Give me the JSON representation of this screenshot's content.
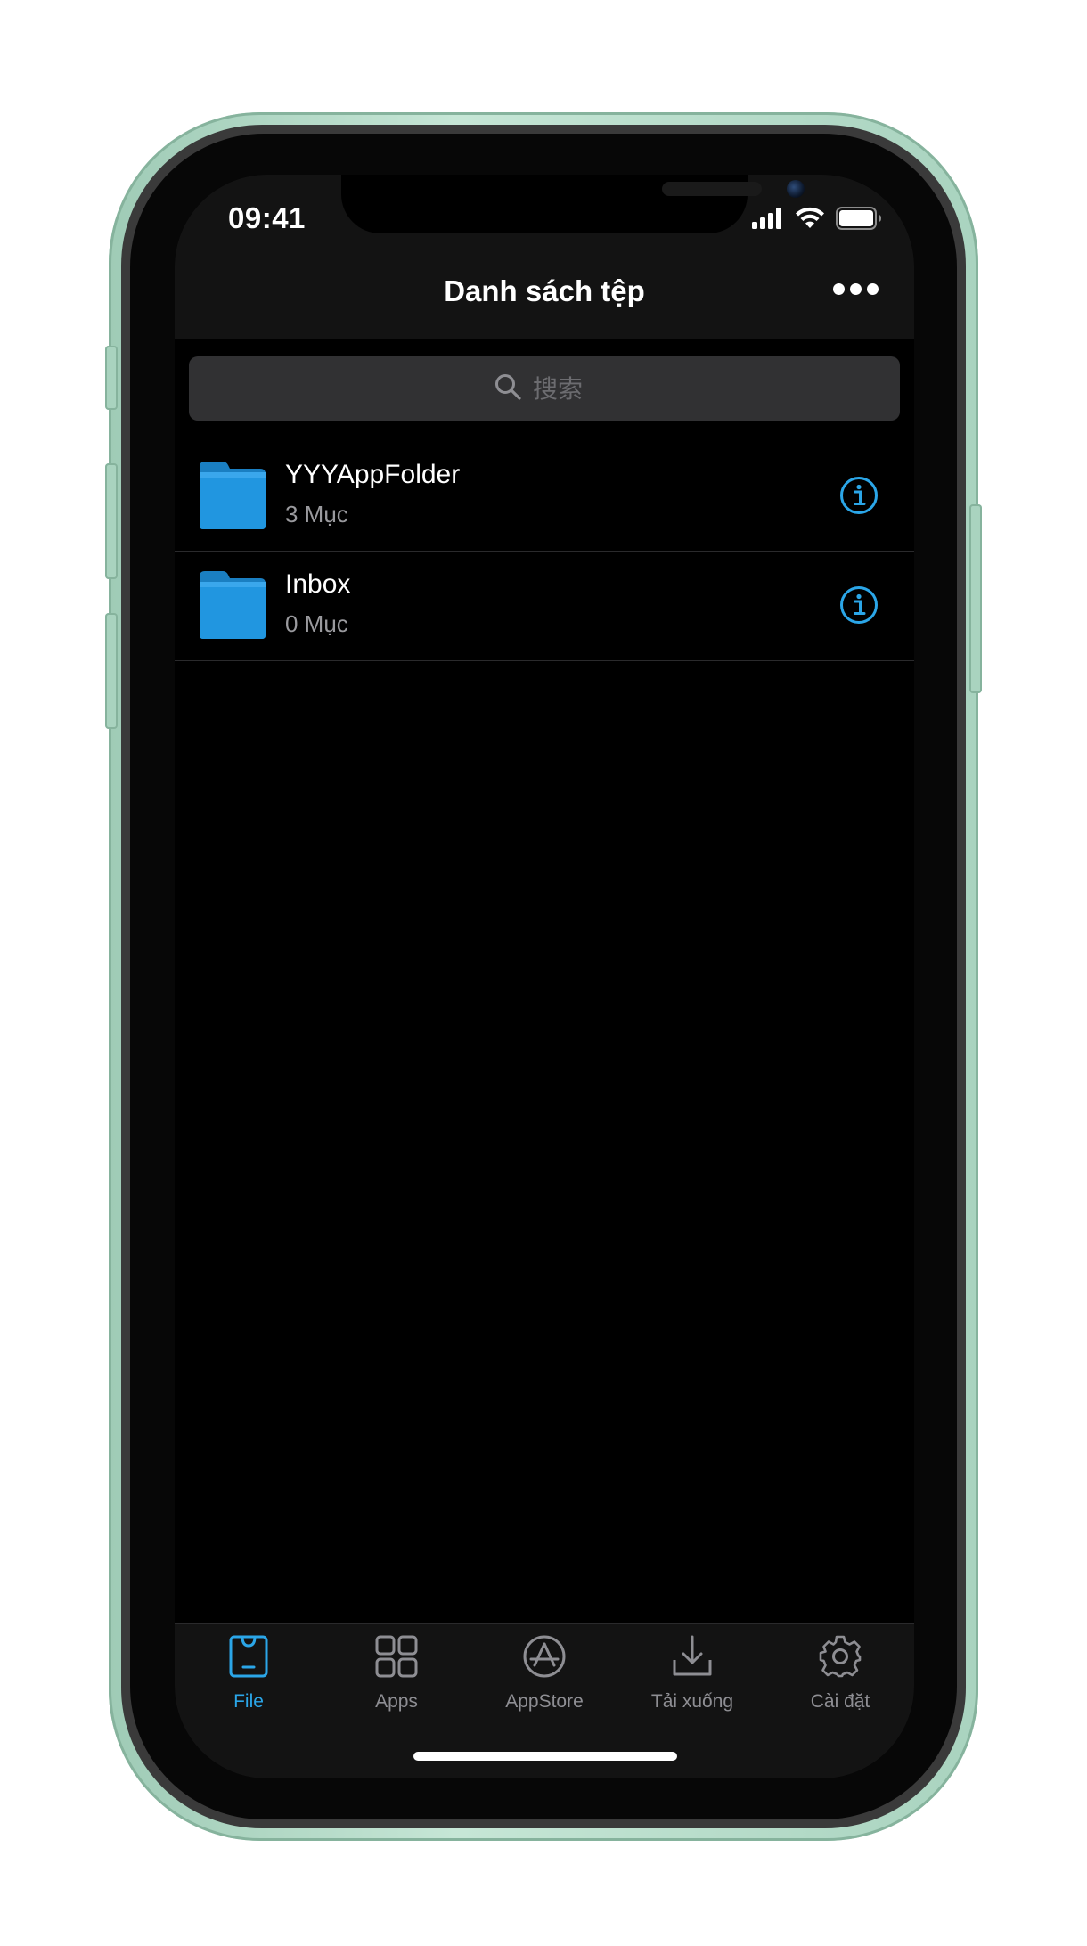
{
  "status": {
    "time": "09:41"
  },
  "nav": {
    "title": "Danh sách tệp",
    "more_icon": "more-horizontal-icon"
  },
  "search": {
    "placeholder": "搜索"
  },
  "files": [
    {
      "name": "YYYAppFolder",
      "count": "3 Mục",
      "icon": "folder-icon"
    },
    {
      "name": "Inbox",
      "count": "0 Mục",
      "icon": "folder-icon"
    }
  ],
  "tabs": [
    {
      "label": "File",
      "icon": "file-bag-icon",
      "active": true
    },
    {
      "label": "Apps",
      "icon": "apps-grid-icon",
      "active": false
    },
    {
      "label": "AppStore",
      "icon": "appstore-icon",
      "active": false
    },
    {
      "label": "Tải xuống",
      "icon": "download-icon",
      "active": false
    },
    {
      "label": "Cài đặt",
      "icon": "settings-gear-icon",
      "active": false
    }
  ],
  "colors": {
    "accent": "#2ba6e8",
    "folder": "#1e8fd6",
    "frame": "#a9d3bf",
    "bar_background": "#131313",
    "inactive_tab": "#8e8e93"
  }
}
